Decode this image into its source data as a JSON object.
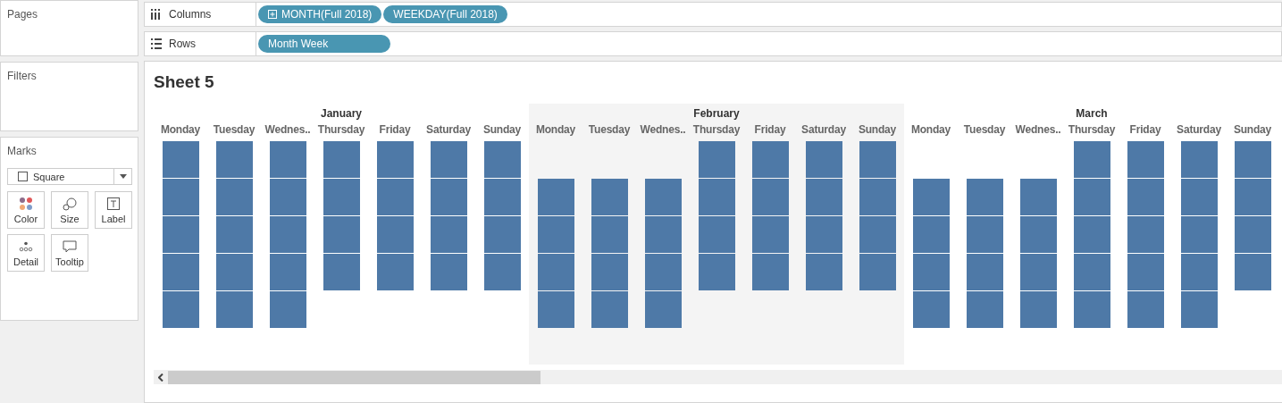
{
  "sidebar": {
    "pages": {
      "title": "Pages"
    },
    "filters": {
      "title": "Filters"
    },
    "marks": {
      "title": "Marks",
      "mark_type": "Square",
      "cards": [
        {
          "kind": "color",
          "label": "Color"
        },
        {
          "kind": "size",
          "label": "Size"
        },
        {
          "kind": "label",
          "label": "Label"
        },
        {
          "kind": "detail",
          "label": "Detail"
        },
        {
          "kind": "tooltip",
          "label": "Tooltip"
        }
      ]
    }
  },
  "shelves": [
    {
      "kind": "columns",
      "label": "Columns",
      "pills": [
        {
          "text": "MONTH(Full 2018)",
          "expandable": true
        },
        {
          "text": "WEEKDAY(Full 2018)",
          "expandable": false
        }
      ]
    },
    {
      "kind": "rows",
      "label": "Rows",
      "pills": [
        {
          "text": "Month Week",
          "expandable": false
        }
      ]
    }
  ],
  "sheet": {
    "title": "Sheet 5",
    "months": [
      {
        "name": "January",
        "shaded": false,
        "days": [
          {
            "name": "Monday",
            "weeks": [
              true,
              true,
              true,
              true,
              true
            ]
          },
          {
            "name": "Tuesday",
            "weeks": [
              true,
              true,
              true,
              true,
              true
            ]
          },
          {
            "name": "Wednes..",
            "weeks": [
              true,
              true,
              true,
              true,
              true
            ]
          },
          {
            "name": "Thursday",
            "weeks": [
              true,
              true,
              true,
              true,
              false
            ]
          },
          {
            "name": "Friday",
            "weeks": [
              true,
              true,
              true,
              true,
              false
            ]
          },
          {
            "name": "Saturday",
            "weeks": [
              true,
              true,
              true,
              true,
              false
            ]
          },
          {
            "name": "Sunday",
            "weeks": [
              true,
              true,
              true,
              true,
              false
            ]
          }
        ]
      },
      {
        "name": "February",
        "shaded": true,
        "days": [
          {
            "name": "Monday",
            "weeks": [
              false,
              true,
              true,
              true,
              true
            ]
          },
          {
            "name": "Tuesday",
            "weeks": [
              false,
              true,
              true,
              true,
              true
            ]
          },
          {
            "name": "Wednes..",
            "weeks": [
              false,
              true,
              true,
              true,
              true
            ]
          },
          {
            "name": "Thursday",
            "weeks": [
              true,
              true,
              true,
              true,
              false
            ]
          },
          {
            "name": "Friday",
            "weeks": [
              true,
              true,
              true,
              true,
              false
            ]
          },
          {
            "name": "Saturday",
            "weeks": [
              true,
              true,
              true,
              true,
              false
            ]
          },
          {
            "name": "Sunday",
            "weeks": [
              true,
              true,
              true,
              true,
              false
            ]
          }
        ]
      },
      {
        "name": "March",
        "shaded": false,
        "days": [
          {
            "name": "Monday",
            "weeks": [
              false,
              true,
              true,
              true,
              true
            ]
          },
          {
            "name": "Tuesday",
            "weeks": [
              false,
              true,
              true,
              true,
              true
            ]
          },
          {
            "name": "Wednes..",
            "weeks": [
              false,
              true,
              true,
              true,
              true
            ]
          },
          {
            "name": "Thursday",
            "weeks": [
              true,
              true,
              true,
              true,
              true
            ]
          },
          {
            "name": "Friday",
            "weeks": [
              true,
              true,
              true,
              true,
              true
            ]
          },
          {
            "name": "Saturday",
            "weeks": [
              true,
              true,
              true,
              true,
              true
            ]
          },
          {
            "name": "Sunday",
            "weeks": [
              true,
              true,
              true,
              true,
              false
            ]
          }
        ]
      }
    ]
  }
}
